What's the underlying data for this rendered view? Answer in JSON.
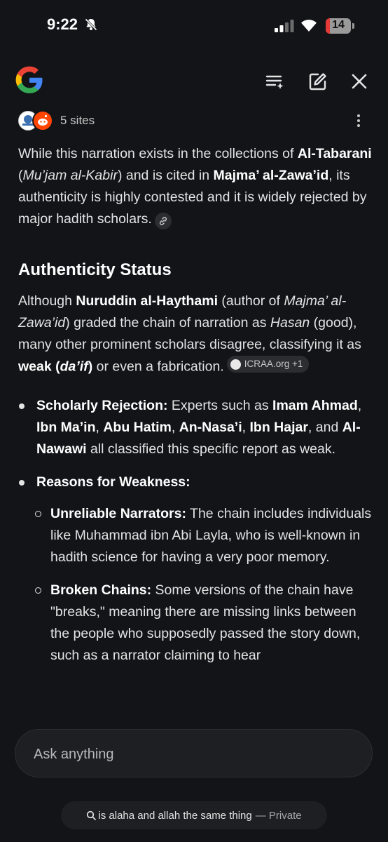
{
  "status_bar": {
    "time": "9:22",
    "battery_level": "14"
  },
  "sources": {
    "label": "5 sites"
  },
  "content": {
    "intro": {
      "t1": "While this narration exists in the collections of ",
      "b1": "Al-Tabarani",
      "t2": " (",
      "i1": "Mu’jam al-Kabir",
      "t3": ") and is cited in ",
      "b2": "Majma’ al-Zawa’id",
      "t4": ", its authenticity is highly contested and it is widely rejected by major hadith scholars."
    },
    "heading": "Authenticity Status",
    "para2": {
      "t1": "Although ",
      "b1": "Nuruddin al-Haythami",
      "t2": " (author of ",
      "i1": "Majma’ al-Zawa’id",
      "t3": ") graded the chain of narration as ",
      "i2": "Hasan",
      "t4": " (good), many other prominent scholars disagree, classifying it as ",
      "b2": "weak (",
      "b2i": "da’if",
      "b2c": ")",
      "t5": " or even a fabrication.",
      "chip": "ICRAA.org +1"
    },
    "bullets": {
      "rejection": {
        "title": "Scholarly Rejection:",
        "t1": " Experts such as ",
        "n1": "Imam Ahmad",
        "c1": ", ",
        "n2": "Ibn Ma’in",
        "c2": ", ",
        "n3": "Abu Hatim",
        "c3": ", ",
        "n4": "An-Nasa’i",
        "c4": ", ",
        "n5": "Ibn Hajar",
        "t2": ", and ",
        "n6": "Al-Nawawi",
        "t3": " all classified this specific report as weak."
      },
      "weakness": {
        "title": "Reasons for Weakness:",
        "sub": [
          {
            "title": "Unreliable Narrators:",
            "text": " The chain includes individuals like Muhammad ibn Abi Layla, who is well-known in hadith science for having a very poor memory."
          },
          {
            "title": "Broken Chains:",
            "text": " Some versions of the chain have \"breaks,\" meaning there are missing links between the people who supposedly passed the story down, such as a narrator claiming to hear"
          }
        ]
      }
    }
  },
  "ask": {
    "placeholder": "Ask anything"
  },
  "query_pill": {
    "query": "is alaha and allah the same thing",
    "mode": "— Private"
  }
}
